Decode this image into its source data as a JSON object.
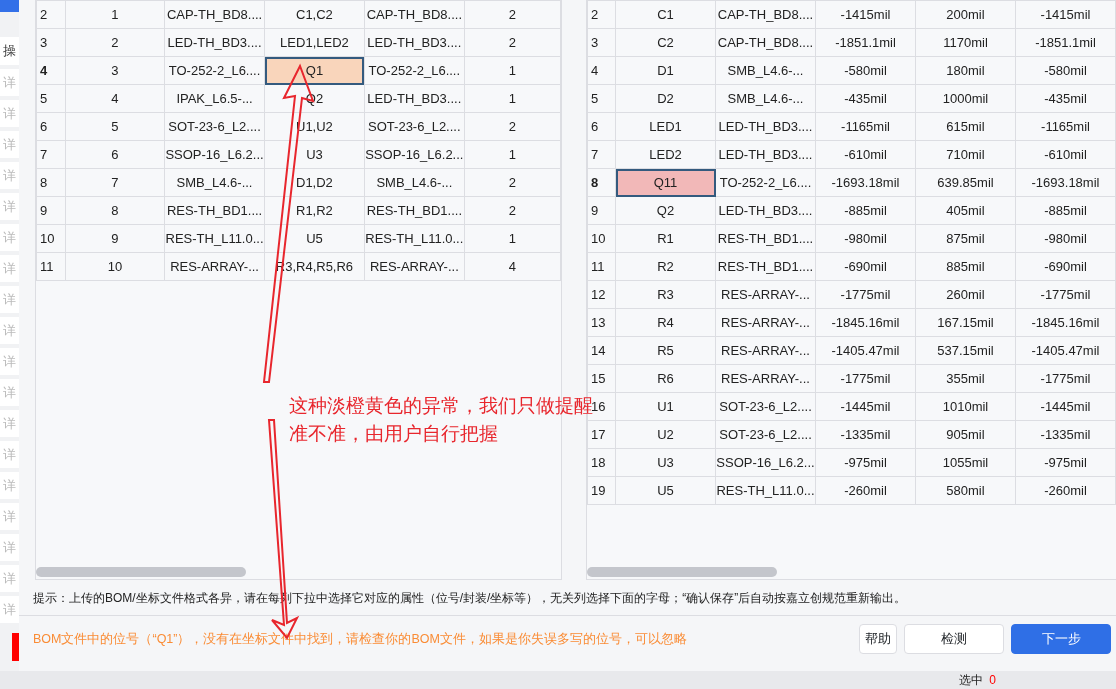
{
  "background_page": {
    "header": "操",
    "items": [
      "详",
      "详",
      "详",
      "详",
      "详",
      "详",
      "详",
      "详",
      "详",
      "详",
      "详",
      "详",
      "详",
      "详",
      "详",
      "详",
      "详",
      "详"
    ],
    "status_label": "选中",
    "status_count": "0"
  },
  "bom_table": {
    "rows": [
      {
        "cells": [
          "2",
          "1",
          "CAP-TH_BD8....",
          "C1,C2",
          "CAP-TH_BD8....",
          "2"
        ],
        "flagged": false
      },
      {
        "cells": [
          "3",
          "2",
          "LED-TH_BD3....",
          "LED1,LED2",
          "LED-TH_BD3....",
          "2"
        ],
        "flagged": false
      },
      {
        "cells": [
          "4",
          "3",
          "TO-252-2_L6....",
          "Q1",
          "TO-252-2_L6....",
          "1"
        ],
        "flagged": true,
        "color": "#f9d5bb"
      },
      {
        "cells": [
          "5",
          "4",
          "IPAK_L6.5-...",
          "Q2",
          "LED-TH_BD3....",
          "1"
        ],
        "flagged": false
      },
      {
        "cells": [
          "6",
          "5",
          "SOT-23-6_L2....",
          "U1,U2",
          "SOT-23-6_L2....",
          "2"
        ],
        "flagged": false
      },
      {
        "cells": [
          "7",
          "6",
          "SSOP-16_L6.2...",
          "U3",
          "SSOP-16_L6.2...",
          "1"
        ],
        "flagged": false
      },
      {
        "cells": [
          "8",
          "7",
          "SMB_L4.6-...",
          "D1,D2",
          "SMB_L4.6-...",
          "2"
        ],
        "flagged": false
      },
      {
        "cells": [
          "9",
          "8",
          "RES-TH_BD1....",
          "R1,R2",
          "RES-TH_BD1....",
          "2"
        ],
        "flagged": false
      },
      {
        "cells": [
          "10",
          "9",
          "RES-TH_L11.0...",
          "U5",
          "RES-TH_L11.0...",
          "1"
        ],
        "flagged": false
      },
      {
        "cells": [
          "11",
          "10",
          "RES-ARRAY-...",
          "R3,R4,R5,R6",
          "RES-ARRAY-...",
          "4"
        ],
        "flagged": false
      }
    ]
  },
  "coordinate_table": {
    "rows": [
      {
        "cells": [
          "2",
          "C1",
          "CAP-TH_BD8....",
          "-1415mil",
          "200mil",
          "-1415mil"
        ],
        "flagged": false
      },
      {
        "cells": [
          "3",
          "C2",
          "CAP-TH_BD8....",
          "-1851.1mil",
          "1170mil",
          "-1851.1mil"
        ],
        "flagged": false
      },
      {
        "cells": [
          "4",
          "D1",
          "SMB_L4.6-...",
          "-580mil",
          "180mil",
          "-580mil"
        ],
        "flagged": false
      },
      {
        "cells": [
          "5",
          "D2",
          "SMB_L4.6-...",
          "-435mil",
          "1000mil",
          "-435mil"
        ],
        "flagged": false
      },
      {
        "cells": [
          "6",
          "LED1",
          "LED-TH_BD3....",
          "-1165mil",
          "615mil",
          "-1165mil"
        ],
        "flagged": false
      },
      {
        "cells": [
          "7",
          "LED2",
          "LED-TH_BD3....",
          "-610mil",
          "710mil",
          "-610mil"
        ],
        "flagged": false
      },
      {
        "cells": [
          "8",
          "Q11",
          "TO-252-2_L6....",
          "-1693.18mil",
          "639.85mil",
          "-1693.18mil"
        ],
        "flagged": true,
        "color": "#f2b8b8"
      },
      {
        "cells": [
          "9",
          "Q2",
          "LED-TH_BD3....",
          "-885mil",
          "405mil",
          "-885mil"
        ],
        "flagged": false
      },
      {
        "cells": [
          "10",
          "R1",
          "RES-TH_BD1....",
          "-980mil",
          "875mil",
          "-980mil"
        ],
        "flagged": false
      },
      {
        "cells": [
          "11",
          "R2",
          "RES-TH_BD1....",
          "-690mil",
          "885mil",
          "-690mil"
        ],
        "flagged": false
      },
      {
        "cells": [
          "12",
          "R3",
          "RES-ARRAY-...",
          "-1775mil",
          "260mil",
          "-1775mil"
        ],
        "flagged": false
      },
      {
        "cells": [
          "13",
          "R4",
          "RES-ARRAY-...",
          "-1845.16mil",
          "167.15mil",
          "-1845.16mil"
        ],
        "flagged": false
      },
      {
        "cells": [
          "14",
          "R5",
          "RES-ARRAY-...",
          "-1405.47mil",
          "537.15mil",
          "-1405.47mil"
        ],
        "flagged": false
      },
      {
        "cells": [
          "15",
          "R6",
          "RES-ARRAY-...",
          "-1775mil",
          "355mil",
          "-1775mil"
        ],
        "flagged": false
      },
      {
        "cells": [
          "16",
          "U1",
          "SOT-23-6_L2....",
          "-1445mil",
          "1010mil",
          "-1445mil"
        ],
        "flagged": false
      },
      {
        "cells": [
          "17",
          "U2",
          "SOT-23-6_L2....",
          "-1335mil",
          "905mil",
          "-1335mil"
        ],
        "flagged": false
      },
      {
        "cells": [
          "18",
          "U3",
          "SSOP-16_L6.2...",
          "-975mil",
          "1055mil",
          "-975mil"
        ],
        "flagged": false
      },
      {
        "cells": [
          "19",
          "U5",
          "RES-TH_L11.0...",
          "-260mil",
          "580mil",
          "-260mil"
        ],
        "flagged": false
      }
    ]
  },
  "hint": "提示：上传的BOM/坐标文件格式各异，请在每列下拉中选择它对应的属性（位号/封装/坐标等），无关列选择下面的字母；“确认保存”后自动按嘉立创规范重新输出。",
  "footer": {
    "message": "BOM文件中的位号（“Q1”），没有在坐标文件中找到，请检查你的BOM文件，如果是你失误多写的位号，可以忽略",
    "buttons": [
      {
        "label": "帮助",
        "kind": "secondary"
      },
      {
        "label": "检测",
        "kind": "outline"
      },
      {
        "label": "下一步",
        "kind": "primary"
      }
    ]
  },
  "annotation": {
    "lines": [
      "这种淡橙黄色的异常，我们只做提醒",
      "准不准，由用户自行把握"
    ]
  }
}
